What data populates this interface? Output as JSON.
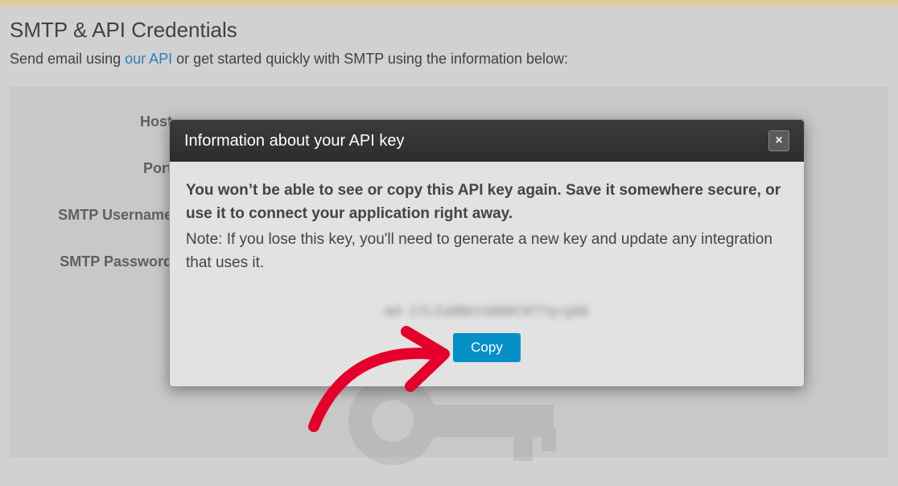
{
  "header": {
    "title": "SMTP & API Credentials",
    "subtitle_pre": "Send email using ",
    "link_text": "our API",
    "subtitle_post": " or get started quickly with SMTP using the information below:"
  },
  "fields": {
    "host": "Host",
    "port": "Port",
    "username": "SMTP Username",
    "password": "SMTP Password"
  },
  "modal": {
    "title": "Information about your API key",
    "warn": "You won’t be able to see or copy this API key again. Save it somewhere secure, or use it to connect your application right away.",
    "note": "Note: If you lose this key, you'll need to generate a new key and update any integration that uses it.",
    "key_preview": "md-17LIoDNktG06KC077qrgAQ",
    "copy_label": "Copy",
    "close_symbol": "×"
  }
}
